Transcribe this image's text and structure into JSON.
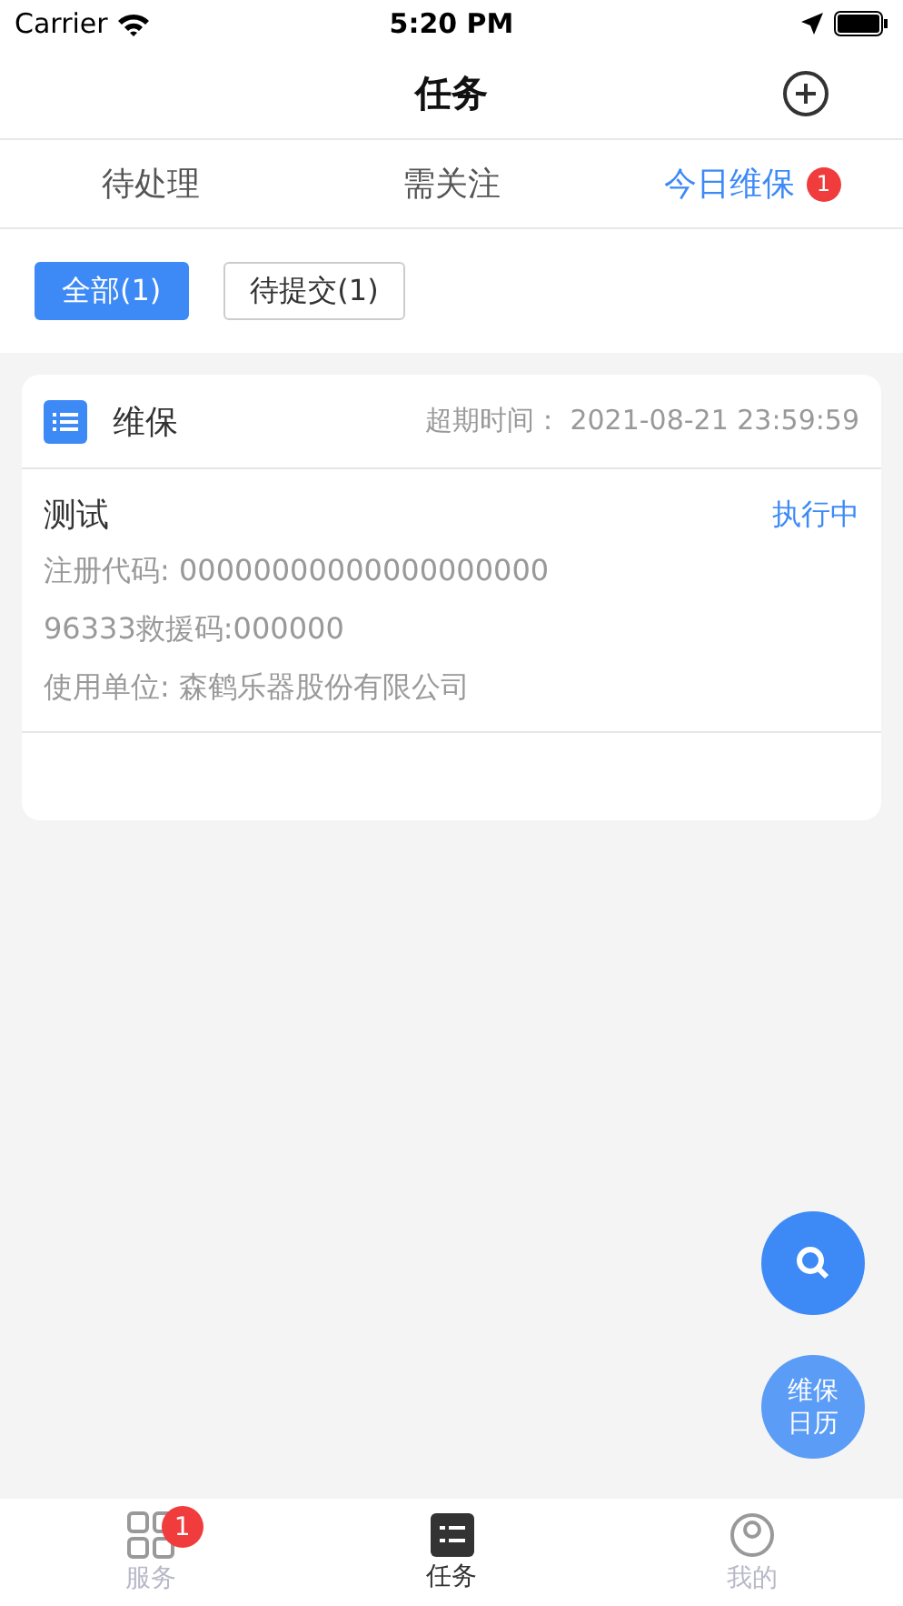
{
  "status_bar": {
    "carrier": "Carrier",
    "time": "5:20 PM"
  },
  "nav": {
    "title": "任务"
  },
  "tabs": [
    {
      "label": "待处理",
      "selected": false
    },
    {
      "label": "需关注",
      "selected": false
    },
    {
      "label": "今日维保",
      "selected": true,
      "badge": "1"
    }
  ],
  "filters": [
    {
      "label": "全部(1)",
      "selected": true
    },
    {
      "label": "待提交(1)",
      "selected": false
    }
  ],
  "task_card": {
    "type": "维保",
    "deadline": "超期时间：  2021-08-21 23:59:59",
    "name": "测试",
    "status": "执行中",
    "details": [
      "注册代码: 00000000000000000000",
      "96333救援码:000000",
      "使用单位: 森鹤乐器股份有限公司"
    ]
  },
  "fab_calendar": {
    "label": [
      "维保",
      "日历"
    ]
  },
  "bottom_tabs": [
    {
      "kind": "grid",
      "label": "服务",
      "selected": false,
      "badge": "1"
    },
    {
      "kind": "list",
      "label": "任务",
      "selected": true
    },
    {
      "kind": "person",
      "label": "我的",
      "selected": false
    }
  ]
}
